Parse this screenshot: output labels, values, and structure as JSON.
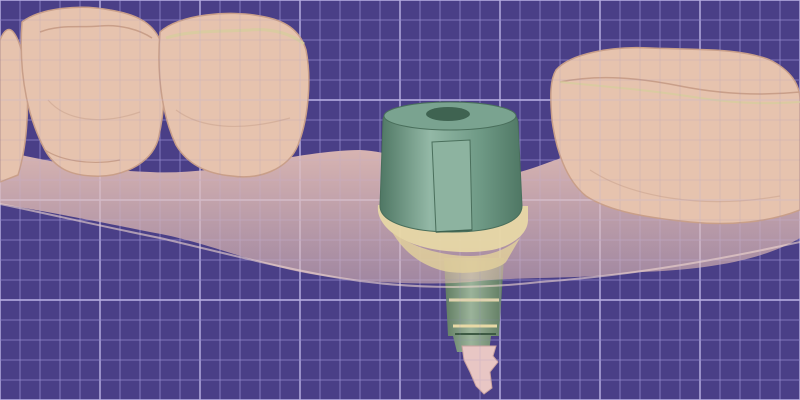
{
  "viewport": {
    "background": "#4a3f87",
    "grid_color": "#8f86c8",
    "grid_color_major": "#b7b0e2",
    "grid_on": true
  },
  "scan": {
    "gingiva_color": "#e7c1b6",
    "tooth_color": "#e6c3ae",
    "tooth_shade": "#c99f89",
    "margin_line_color": "#c9b99a"
  },
  "abutment": {
    "body_color": "#6f9a86",
    "highlight_color": "#93b8a6",
    "shadow_color": "#4f7764",
    "collar_color": "#e8d9a6",
    "post_color": "#7a9478",
    "tip_color": "#e8c6c4"
  }
}
